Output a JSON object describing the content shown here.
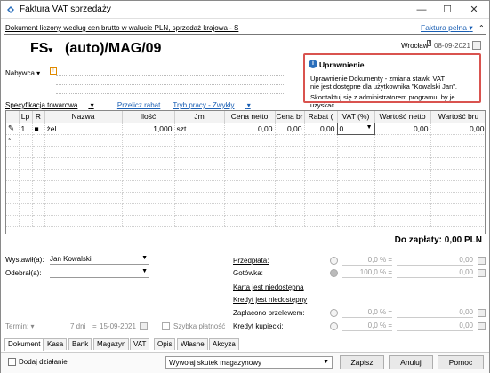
{
  "window": {
    "title": "Faktura VAT sprzedaży",
    "minimize": "—",
    "maximize": "☐",
    "close": "✕"
  },
  "header": {
    "subtitle": "Dokument liczony według cen brutto w walucie PLN, sprzedaż krajowa - S",
    "faktura_link": "Faktura pełna",
    "doc_type": "FS",
    "doc_number": "(auto)/MAG/09",
    "place": "Wrocław",
    "date": "08-09-2021"
  },
  "buyer": {
    "label": "Nabywca"
  },
  "grid_toolbar": {
    "spec": "Specyfikacja towarowa",
    "przelicz": "Przelicz rabat",
    "tryb": "Tryb pracy - Zwykły"
  },
  "grid": {
    "columns": [
      "",
      "Lp",
      "R",
      "Nazwa",
      "Ilość",
      "Jm",
      "Cena netto",
      "Cena br",
      "Rabat (",
      "VAT (%)",
      "Wartość netto",
      "Wartość bru"
    ],
    "rows": [
      {
        "icon": "✎",
        "lp": "1",
        "r": "■",
        "nazwa": "żel",
        "ilosc": "1,000",
        "jm": "szt.",
        "cena_netto": "0,00",
        "cena_brutto": "0,00",
        "rabat": "0,00",
        "vat": "0",
        "wart_netto": "0,00",
        "wart_brutto": "0,00"
      }
    ],
    "new_row_marker": "*"
  },
  "total": "Do zapłaty: 0,00 PLN",
  "left_form": {
    "wystawil_label": "Wystawił(a):",
    "wystawil_value": "Jan Kowalski",
    "odebral_label": "Odebrał(a):",
    "termin_label": "Termin:",
    "termin_days": "7 dni",
    "termin_date": "15-09-2021",
    "szybka": "Szybka płatność"
  },
  "right_form": {
    "przedplata": "Przedpłata:",
    "gotowka": "Gotówka:",
    "karta": "Karta jest niedostępna",
    "kredyt": "Kredyt jest niedostępny",
    "zaplacono": "Zapłacono przelewem:",
    "kredyt_kupiecki": "Kredyt kupiecki:",
    "pct1": "0,0 % =",
    "pct2": "100,0 % =",
    "pct3": "0,0 % =",
    "pct4": "0,0 % =",
    "val": "0,00"
  },
  "tabs": [
    "Dokument",
    "Kasa",
    "Bank",
    "Magazyn",
    "VAT",
    "Opis",
    "Własne",
    "Akcyza"
  ],
  "bottom": {
    "dodaj": "Dodaj działanie",
    "skutek": "Wywołaj skutek magazynowy",
    "zapisz": "Zapisz",
    "anuluj": "Anuluj",
    "pomoc": "Pomoc"
  },
  "popup": {
    "title": "Uprawnienie",
    "line1": "Uprawnienie Dokumenty - zmiana stawki VAT",
    "line2": "nie jest dostępne dla użytkownika \"Kowalski Jan\".",
    "line3": "Skontaktuj się z administratorem programu, by je uzyskać."
  },
  "colors": {
    "link": "#1a5fb4",
    "popup_border": "#d9534f",
    "info_icon": "#2a6ebb"
  }
}
